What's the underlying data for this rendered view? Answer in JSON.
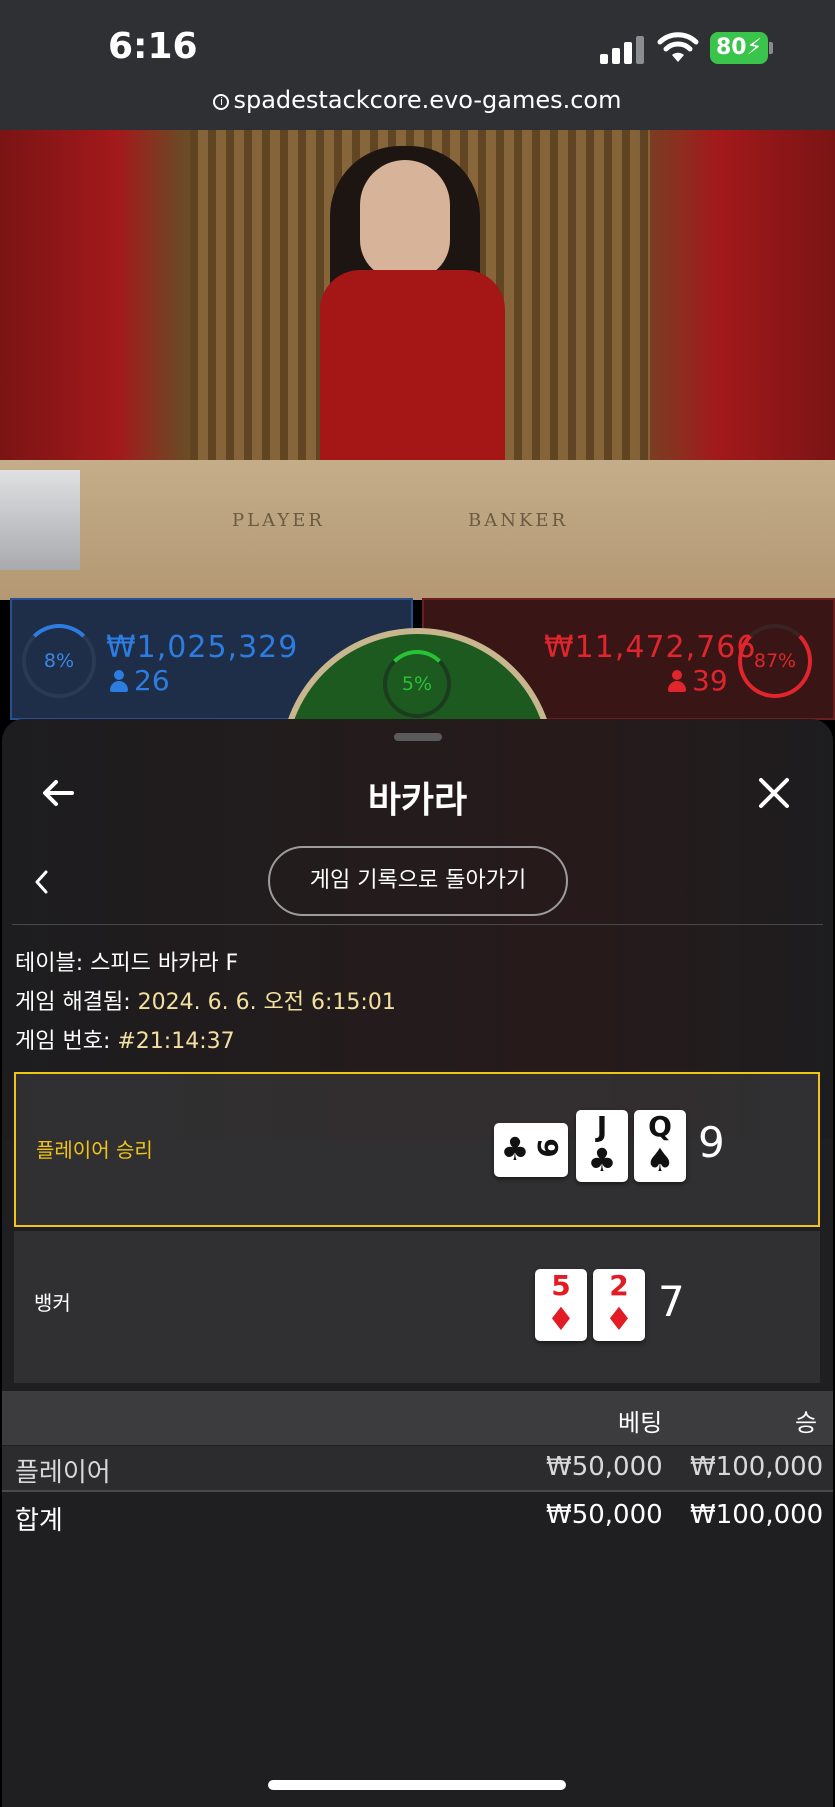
{
  "status_bar": {
    "time": "6:16",
    "battery": "80",
    "url": "spadestackcore.evo-games.com"
  },
  "video": {
    "table_player_word": "PLAYER",
    "table_banker_word": "BANKER"
  },
  "bets": {
    "player_percent": "8%",
    "player_amount": "₩1,025,329",
    "player_count": "26",
    "tie_percent": "5%",
    "banker_percent": "87%",
    "banker_amount": "₩11,472,766",
    "banker_count": "39",
    "colors": {
      "player": "#2d7de0",
      "banker": "#e0262c",
      "tie": "#27c335"
    }
  },
  "sheet": {
    "title": "바카라",
    "back_to_history": "게임 기록으로 돌아가기",
    "table_label": "테이블: 스피드 바카라 F",
    "resolved_label": "게임 해결됨: ",
    "resolved_value": "2024. 6. 6. 오전 6:15:01",
    "game_no_label": "게임 번호: ",
    "game_no_value": "#21:14:37"
  },
  "results": {
    "player": {
      "label": "플레이어 승리",
      "cards": [
        {
          "rank": "9",
          "suit": "♣",
          "color": "black",
          "sideways": true
        },
        {
          "rank": "J",
          "suit": "♣",
          "color": "black"
        },
        {
          "rank": "Q",
          "suit": "♠",
          "color": "black"
        }
      ],
      "score": "9",
      "highlight_color": "#f0c419"
    },
    "banker": {
      "label": "뱅커",
      "cards": [
        {
          "rank": "5",
          "suit": "♦",
          "color": "red"
        },
        {
          "rank": "2",
          "suit": "♦",
          "color": "red"
        }
      ],
      "score": "7"
    }
  },
  "bet_table": {
    "headers": {
      "bet": "베팅",
      "win": "승"
    },
    "rows": [
      {
        "name": "플레이어",
        "bet": "₩50,000",
        "win": "₩100,000"
      },
      {
        "name": "합계",
        "bet": "₩50,000",
        "win": "₩100,000"
      }
    ]
  }
}
